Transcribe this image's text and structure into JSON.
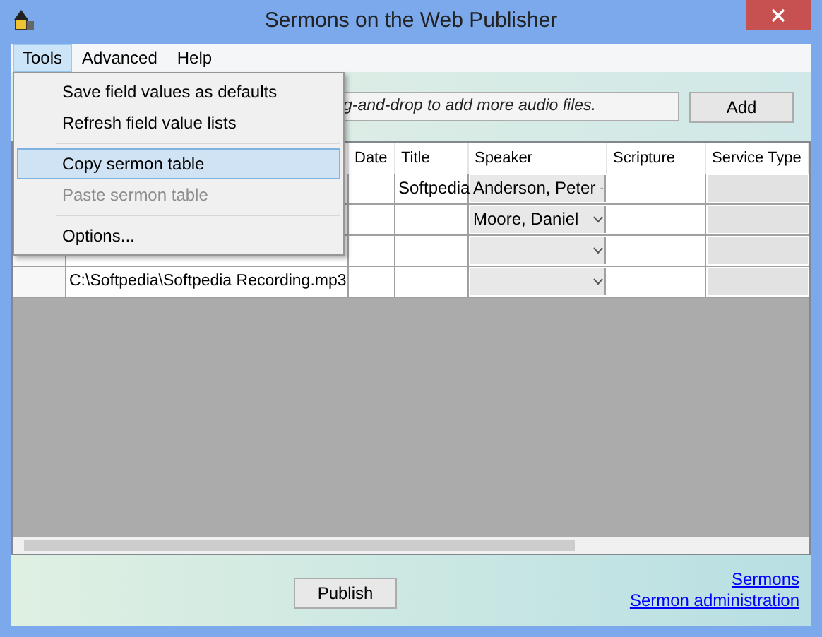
{
  "window": {
    "title": "Sermons on the Web Publisher"
  },
  "menu_bar": [
    {
      "label": "Tools",
      "selected": true
    },
    {
      "label": "Advanced",
      "selected": false
    },
    {
      "label": "Help",
      "selected": false
    }
  ],
  "menu": [
    {
      "kind": "item",
      "label": "Save field values as defaults",
      "selected": false,
      "disabled": false
    },
    {
      "kind": "item",
      "label": "Refresh field value lists",
      "selected": false,
      "disabled": false
    },
    {
      "kind": "separator"
    },
    {
      "kind": "item",
      "label": "Copy sermon table",
      "selected": true,
      "disabled": false
    },
    {
      "kind": "item",
      "label": "Paste sermon table",
      "selected": false,
      "disabled": true
    },
    {
      "kind": "separator"
    },
    {
      "kind": "item",
      "label": "Options...",
      "selected": false,
      "disabled": false
    }
  ],
  "files_field": {
    "placeholder": "g-and-drop to add more audio files."
  },
  "add_button": "Add",
  "table": {
    "columns": [
      "Date",
      "Title",
      "Speaker",
      "Scripture",
      "Service Type"
    ],
    "rows": [
      {
        "file": "",
        "date": "",
        "title": "Softpedia",
        "speaker": "Anderson, Peter",
        "scripture": ""
      },
      {
        "file": "",
        "date": "",
        "title": "",
        "speaker": "Moore, Daniel",
        "scripture": ""
      },
      {
        "file": "",
        "date": "",
        "title": "",
        "speaker": "",
        "scripture": ""
      },
      {
        "file": "C:\\Softpedia\\Softpedia Recording.mp3",
        "date": "",
        "title": "",
        "speaker": "",
        "scripture": ""
      }
    ]
  },
  "publish_button": "Publish",
  "links": [
    "Sermons",
    "Sermon administration"
  ]
}
